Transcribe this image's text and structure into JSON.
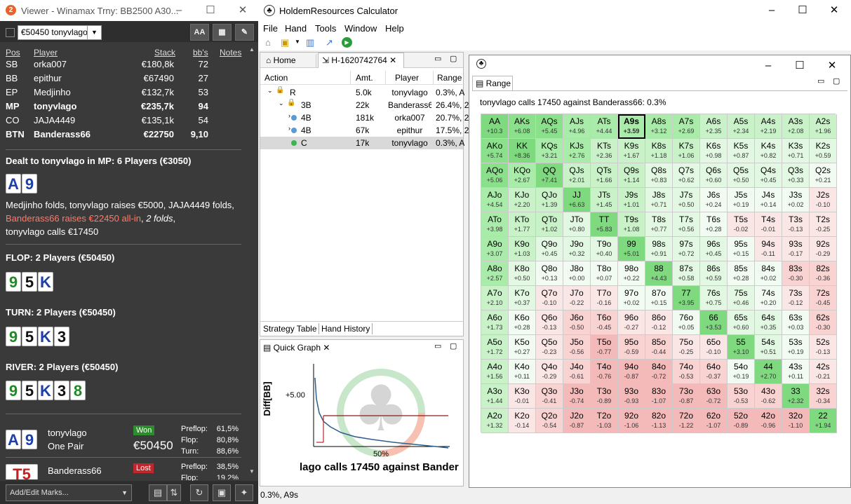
{
  "viewer": {
    "title": "Viewer - Winamax Trny: BB2500 A30...",
    "badge": "2",
    "select": "€50450 tonyvlago",
    "btn_aa": "AA",
    "headers": {
      "pos": "Pos",
      "player": "Player",
      "stack": "Stack",
      "bbs": "bb's",
      "notes": "Notes"
    },
    "players": [
      {
        "pos": "SB",
        "name": "orka007",
        "stack": "€180,8k",
        "bbs": "72",
        "bold": false
      },
      {
        "pos": "BB",
        "name": "epithur",
        "stack": "€67490",
        "bbs": "27",
        "bold": false
      },
      {
        "pos": "EP",
        "name": "Medjinho",
        "stack": "€132,7k",
        "bbs": "53",
        "bold": false
      },
      {
        "pos": "MP",
        "name": "tonyvlago",
        "stack": "€235,7k",
        "bbs": "94",
        "bold": true
      },
      {
        "pos": "CO",
        "name": "JAJA4449",
        "stack": "€135,1k",
        "bbs": "54",
        "bold": false
      },
      {
        "pos": "BTN",
        "name": "Banderass66",
        "stack": "€22750",
        "bbs": "9,10",
        "bold": true
      }
    ],
    "dealt": "Dealt to tonyvlago in MP: 6 Players (€3050)",
    "hole": [
      {
        "r": "A",
        "c": "b"
      },
      {
        "r": "9",
        "c": "b"
      }
    ],
    "action1": "Medjinho folds, tonyvlago raises €5000, JAJA4449 folds, ",
    "action_red": "Banderass66 raises €22450 all-in",
    "action2": ", ",
    "action_it": "2 folds",
    "action3": ",",
    "action4": "tonyvlago calls €17450",
    "flop": "FLOP: 2 Players (€50450)",
    "turn": "TURN: 2 Players (€50450)",
    "river": "RIVER: 2 Players (€50450)",
    "board": [
      {
        "r": "9",
        "c": "g"
      },
      {
        "r": "5",
        "c": "k"
      },
      {
        "r": "K",
        "c": "b"
      },
      {
        "r": "3",
        "c": "k"
      },
      {
        "r": "8",
        "c": "g"
      }
    ],
    "res1": {
      "name": "tonyvlago",
      "hand": "One Pair",
      "badge": "Won",
      "amount": "€50450",
      "pre": "Preflop:",
      "pre_v": "61,5%",
      "flop": "Flop:",
      "flop_v": "80,8%",
      "turn": "Turn:",
      "turn_v": "88,6%"
    },
    "res2": {
      "name": "Banderass66",
      "badge": "Lost",
      "pre": "Preflop:",
      "pre_v": "38,5%",
      "flop": "Flop:",
      "flop_v": "19,2%",
      "cards": "T5"
    },
    "marks": "Add/Edit Marks..."
  },
  "calc": {
    "title": "HoldemResources Calculator",
    "menu": [
      "File",
      "Hand",
      "Tools",
      "Window",
      "Help"
    ],
    "tabs": {
      "home": "Home",
      "hand": "H-1620742764"
    },
    "cols": {
      "action": "Action",
      "amt": "Amt.",
      "player": "Player",
      "range": "Range"
    },
    "tree": [
      {
        "a": "R",
        "amt": "5.0k",
        "p": "tonyvlago",
        "r": "0.3%, A"
      },
      {
        "a": "3B",
        "amt": "22k",
        "p": "Banderass66",
        "r": "26.4%, 2"
      },
      {
        "a": "4B",
        "amt": "181k",
        "p": "orka007",
        "r": "20.7%, 2"
      },
      {
        "a": "4B",
        "amt": "67k",
        "p": "epithur",
        "r": "17.5%, 2"
      },
      {
        "a": "C",
        "amt": "17k",
        "p": "tonyvlago",
        "r": "0.3%, A"
      }
    ],
    "bottom_tabs": [
      "Strategy Table",
      "Hand History"
    ],
    "qg": {
      "title": "Quick Graph",
      "ylabel": "Diff[BB]",
      "ytick": "+5.00",
      "xtick": "50%",
      "caption": "lago calls 17450 against Bander"
    },
    "range": {
      "title": "Range",
      "desc": "tonyvlago calls 17450 against Banderass66: 0.3%"
    },
    "status": "0.3%, A9s"
  },
  "grid": [
    [
      [
        "AA",
        "+10.3"
      ],
      [
        "AKs",
        "+6.08"
      ],
      [
        "AQs",
        "+5.45"
      ],
      [
        "AJs",
        "+4.96"
      ],
      [
        "ATs",
        "+4.44"
      ],
      [
        "A9s",
        "+3.59"
      ],
      [
        "A8s",
        "+3.12"
      ],
      [
        "A7s",
        "+2.69"
      ],
      [
        "A6s",
        "+2.35"
      ],
      [
        "A5s",
        "+2.34"
      ],
      [
        "A4s",
        "+2.19"
      ],
      [
        "A3s",
        "+2.08"
      ],
      [
        "A2s",
        "+1.96"
      ]
    ],
    [
      [
        "AKo",
        "+5.74"
      ],
      [
        "KK",
        "+8.36"
      ],
      [
        "KQs",
        "+3.21"
      ],
      [
        "KJs",
        "+2.76"
      ],
      [
        "KTs",
        "+2.36"
      ],
      [
        "K9s",
        "+1.67"
      ],
      [
        "K8s",
        "+1.18"
      ],
      [
        "K7s",
        "+1.06"
      ],
      [
        "K6s",
        "+0.98"
      ],
      [
        "K5s",
        "+0.87"
      ],
      [
        "K4s",
        "+0.82"
      ],
      [
        "K3s",
        "+0.71"
      ],
      [
        "K2s",
        "+0.59"
      ]
    ],
    [
      [
        "AQo",
        "+5.06"
      ],
      [
        "KQo",
        "+2.67"
      ],
      [
        "QQ",
        "+7.41"
      ],
      [
        "QJs",
        "+2.01"
      ],
      [
        "QTs",
        "+1.66"
      ],
      [
        "Q9s",
        "+1.14"
      ],
      [
        "Q8s",
        "+0.83"
      ],
      [
        "Q7s",
        "+0.62"
      ],
      [
        "Q6s",
        "+0.60"
      ],
      [
        "Q5s",
        "+0.50"
      ],
      [
        "Q4s",
        "+0.45"
      ],
      [
        "Q3s",
        "+0.33"
      ],
      [
        "Q2s",
        "+0.21"
      ]
    ],
    [
      [
        "AJo",
        "+4.54"
      ],
      [
        "KJo",
        "+2.20"
      ],
      [
        "QJo",
        "+1.39"
      ],
      [
        "JJ",
        "+6.63"
      ],
      [
        "JTs",
        "+1.45"
      ],
      [
        "J9s",
        "+1.01"
      ],
      [
        "J8s",
        "+0.71"
      ],
      [
        "J7s",
        "+0.50"
      ],
      [
        "J6s",
        "+0.24"
      ],
      [
        "J5s",
        "+0.19"
      ],
      [
        "J4s",
        "+0.14"
      ],
      [
        "J3s",
        "+0.02"
      ],
      [
        "J2s",
        "-0.10"
      ]
    ],
    [
      [
        "ATo",
        "+3.98"
      ],
      [
        "KTo",
        "+1.77"
      ],
      [
        "QTo",
        "+1.02"
      ],
      [
        "JTo",
        "+0.80"
      ],
      [
        "TT",
        "+5.83"
      ],
      [
        "T9s",
        "+1.08"
      ],
      [
        "T8s",
        "+0.77"
      ],
      [
        "T7s",
        "+0.56"
      ],
      [
        "T6s",
        "+0.28"
      ],
      [
        "T5s",
        "-0.02"
      ],
      [
        "T4s",
        "-0.01"
      ],
      [
        "T3s",
        "-0.13"
      ],
      [
        "T2s",
        "-0.25"
      ]
    ],
    [
      [
        "A9o",
        "+3.07"
      ],
      [
        "K9o",
        "+1.03"
      ],
      [
        "Q9o",
        "+0.45"
      ],
      [
        "J9o",
        "+0.32"
      ],
      [
        "T9o",
        "+0.40"
      ],
      [
        "99",
        "+5.01"
      ],
      [
        "98s",
        "+0.91"
      ],
      [
        "97s",
        "+0.72"
      ],
      [
        "96s",
        "+0.45"
      ],
      [
        "95s",
        "+0.15"
      ],
      [
        "94s",
        "-0.11"
      ],
      [
        "93s",
        "-0.17"
      ],
      [
        "92s",
        "-0.29"
      ]
    ],
    [
      [
        "A8o",
        "+2.57"
      ],
      [
        "K8o",
        "+0.50"
      ],
      [
        "Q8o",
        "+0.13"
      ],
      [
        "J8o",
        "+0.00"
      ],
      [
        "T8o",
        "+0.07"
      ],
      [
        "98o",
        "+0.22"
      ],
      [
        "88",
        "+4.43"
      ],
      [
        "87s",
        "+0.58"
      ],
      [
        "86s",
        "+0.59"
      ],
      [
        "85s",
        "+0.28"
      ],
      [
        "84s",
        "+0.02"
      ],
      [
        "83s",
        "-0.30"
      ],
      [
        "82s",
        "-0.36"
      ]
    ],
    [
      [
        "A7o",
        "+2.10"
      ],
      [
        "K7o",
        "+0.37"
      ],
      [
        "Q7o",
        "-0.10"
      ],
      [
        "J7o",
        "-0.22"
      ],
      [
        "T7o",
        "-0.16"
      ],
      [
        "97o",
        "+0.02"
      ],
      [
        "87o",
        "+0.15"
      ],
      [
        "77",
        "+3.95"
      ],
      [
        "76s",
        "+0.75"
      ],
      [
        "75s",
        "+0.46"
      ],
      [
        "74s",
        "+0.20"
      ],
      [
        "73s",
        "-0.12"
      ],
      [
        "72s",
        "-0.45"
      ]
    ],
    [
      [
        "A6o",
        "+1.73"
      ],
      [
        "K6o",
        "+0.28"
      ],
      [
        "Q6o",
        "-0.13"
      ],
      [
        "J6o",
        "-0.50"
      ],
      [
        "T6o",
        "-0.45"
      ],
      [
        "96o",
        "-0.27"
      ],
      [
        "86o",
        "-0.12"
      ],
      [
        "76o",
        "+0.05"
      ],
      [
        "66",
        "+3.53"
      ],
      [
        "65s",
        "+0.60"
      ],
      [
        "64s",
        "+0.35"
      ],
      [
        "63s",
        "+0.03"
      ],
      [
        "62s",
        "-0.30"
      ]
    ],
    [
      [
        "A5o",
        "+1.72"
      ],
      [
        "K5o",
        "+0.27"
      ],
      [
        "Q5o",
        "-0.23"
      ],
      [
        "J5o",
        "-0.56"
      ],
      [
        "T5o",
        "-0.77"
      ],
      [
        "95o",
        "-0.59"
      ],
      [
        "85o",
        "-0.44"
      ],
      [
        "75o",
        "-0.25"
      ],
      [
        "65o",
        "-0.10"
      ],
      [
        "55",
        "+3.10"
      ],
      [
        "54s",
        "+0.51"
      ],
      [
        "53s",
        "+0.19"
      ],
      [
        "52s",
        "-0.13"
      ]
    ],
    [
      [
        "A4o",
        "+1.56"
      ],
      [
        "K4o",
        "+0.11"
      ],
      [
        "Q4o",
        "-0.29"
      ],
      [
        "J4o",
        "-0.61"
      ],
      [
        "T4o",
        "-0.76"
      ],
      [
        "94o",
        "-0.87"
      ],
      [
        "84o",
        "-0.72"
      ],
      [
        "74o",
        "-0.53"
      ],
      [
        "64o",
        "-0.37"
      ],
      [
        "54o",
        "+0.19"
      ],
      [
        "44",
        "+2.70"
      ],
      [
        "43s",
        "+0.11"
      ],
      [
        "42s",
        "-0.21"
      ]
    ],
    [
      [
        "A3o",
        "+1.44"
      ],
      [
        "K3o",
        "-0.01"
      ],
      [
        "Q3o",
        "-0.41"
      ],
      [
        "J3o",
        "-0.74"
      ],
      [
        "T3o",
        "-0.89"
      ],
      [
        "93o",
        "-0.93"
      ],
      [
        "83o",
        "-1.07"
      ],
      [
        "73o",
        "-0.87"
      ],
      [
        "63o",
        "-0.72"
      ],
      [
        "53o",
        "-0.53"
      ],
      [
        "43o",
        "-0.62"
      ],
      [
        "33",
        "+2.32"
      ],
      [
        "32s",
        "-0.34"
      ]
    ],
    [
      [
        "A2o",
        "+1.32"
      ],
      [
        "K2o",
        "-0.14"
      ],
      [
        "Q2o",
        "-0.54"
      ],
      [
        "J2o",
        "-0.87"
      ],
      [
        "T2o",
        "-1.03"
      ],
      [
        "92o",
        "-1.06"
      ],
      [
        "82o",
        "-1.13"
      ],
      [
        "72o",
        "-1.22"
      ],
      [
        "62o",
        "-1.07"
      ],
      [
        "52o",
        "-0.89"
      ],
      [
        "42o",
        "-0.96"
      ],
      [
        "32o",
        "-1.10"
      ],
      [
        "22",
        "+1.94"
      ]
    ]
  ],
  "selected_cell": "A9s"
}
